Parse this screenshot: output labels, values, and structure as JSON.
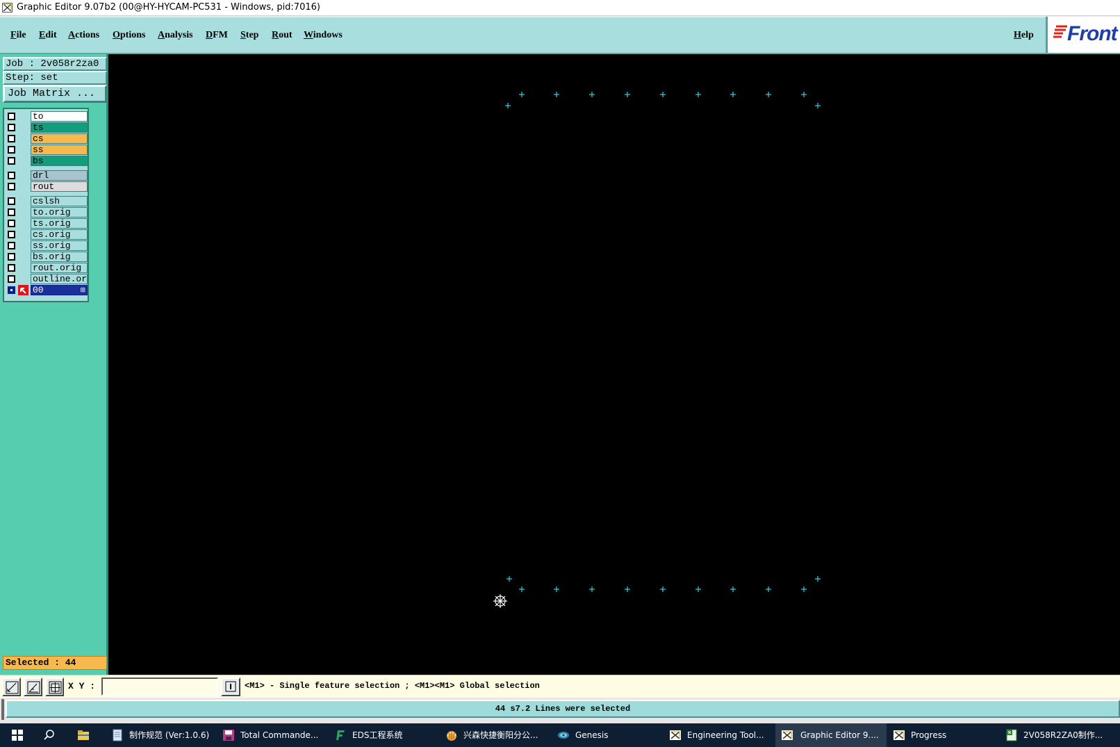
{
  "window": {
    "title": "Graphic Editor 9.07b2 (00@HY-HYCAM-PC531 - Windows, pid:7016)"
  },
  "menubar": {
    "items": [
      "File",
      "Edit",
      "Actions",
      "Options",
      "Analysis",
      "DFM",
      "Step",
      "Rout",
      "Windows"
    ],
    "help": "Help",
    "logo_text": "Front"
  },
  "leftpanel": {
    "job": "Job : 2v058r2za0",
    "step": "Step: set",
    "job_matrix": "Job Matrix ...",
    "layers": [
      {
        "name": "to",
        "color": "#ffffff"
      },
      {
        "name": "ts",
        "color": "#119e7b"
      },
      {
        "name": "cs",
        "color": "#f7b84e"
      },
      {
        "name": "ss",
        "color": "#f7b84e"
      },
      {
        "name": "bs",
        "color": "#119e7b"
      },
      {
        "name": "drl",
        "color": "#a7c4cf"
      },
      {
        "name": "rout",
        "color": "#dcdcdc"
      },
      {
        "name": "cslsh",
        "color": "#a8dede"
      },
      {
        "name": "to.orig",
        "color": "#a8dede"
      },
      {
        "name": "ts.orig",
        "color": "#a8dede"
      },
      {
        "name": "cs.orig",
        "color": "#a8dede"
      },
      {
        "name": "ss.orig",
        "color": "#a8dede"
      },
      {
        "name": "bs.orig",
        "color": "#a8dede"
      },
      {
        "name": "rout.orig",
        "color": "#a8dede"
      },
      {
        "name": "outline.orig",
        "color": "#a8dede"
      },
      {
        "name": "00",
        "color": "#1b2f9a",
        "work": true
      }
    ],
    "selected": "Selected : 44"
  },
  "canvas": {
    "background": "#000000",
    "marker_color": "#35c4d6"
  },
  "command": {
    "xy_label": "X Y :",
    "xy_value": "",
    "prompt": "<M1> - Single feature selection ; <M1><M1> Global selection",
    "message": "44 s7.2 Lines were selected"
  },
  "taskbar": {
    "items": [
      {
        "label": "制作规范 (Ver:1.0.6)",
        "icon": "document-icon"
      },
      {
        "label": "Total Commande...",
        "icon": "floppy-icon"
      },
      {
        "label": "EDS工程系统",
        "icon": "eds-icon"
      },
      {
        "label": "兴森快捷衡阳分公...",
        "icon": "shell-icon"
      },
      {
        "label": "Genesis",
        "icon": "genesis-icon"
      },
      {
        "label": "Engineering Tool...",
        "icon": "app-icon"
      },
      {
        "label": "Graphic Editor 9....",
        "icon": "app-icon",
        "active": true
      },
      {
        "label": "Progress",
        "icon": "app-icon"
      },
      {
        "label": "2V058R2ZA0制作...",
        "icon": "sheet-icon"
      }
    ]
  }
}
